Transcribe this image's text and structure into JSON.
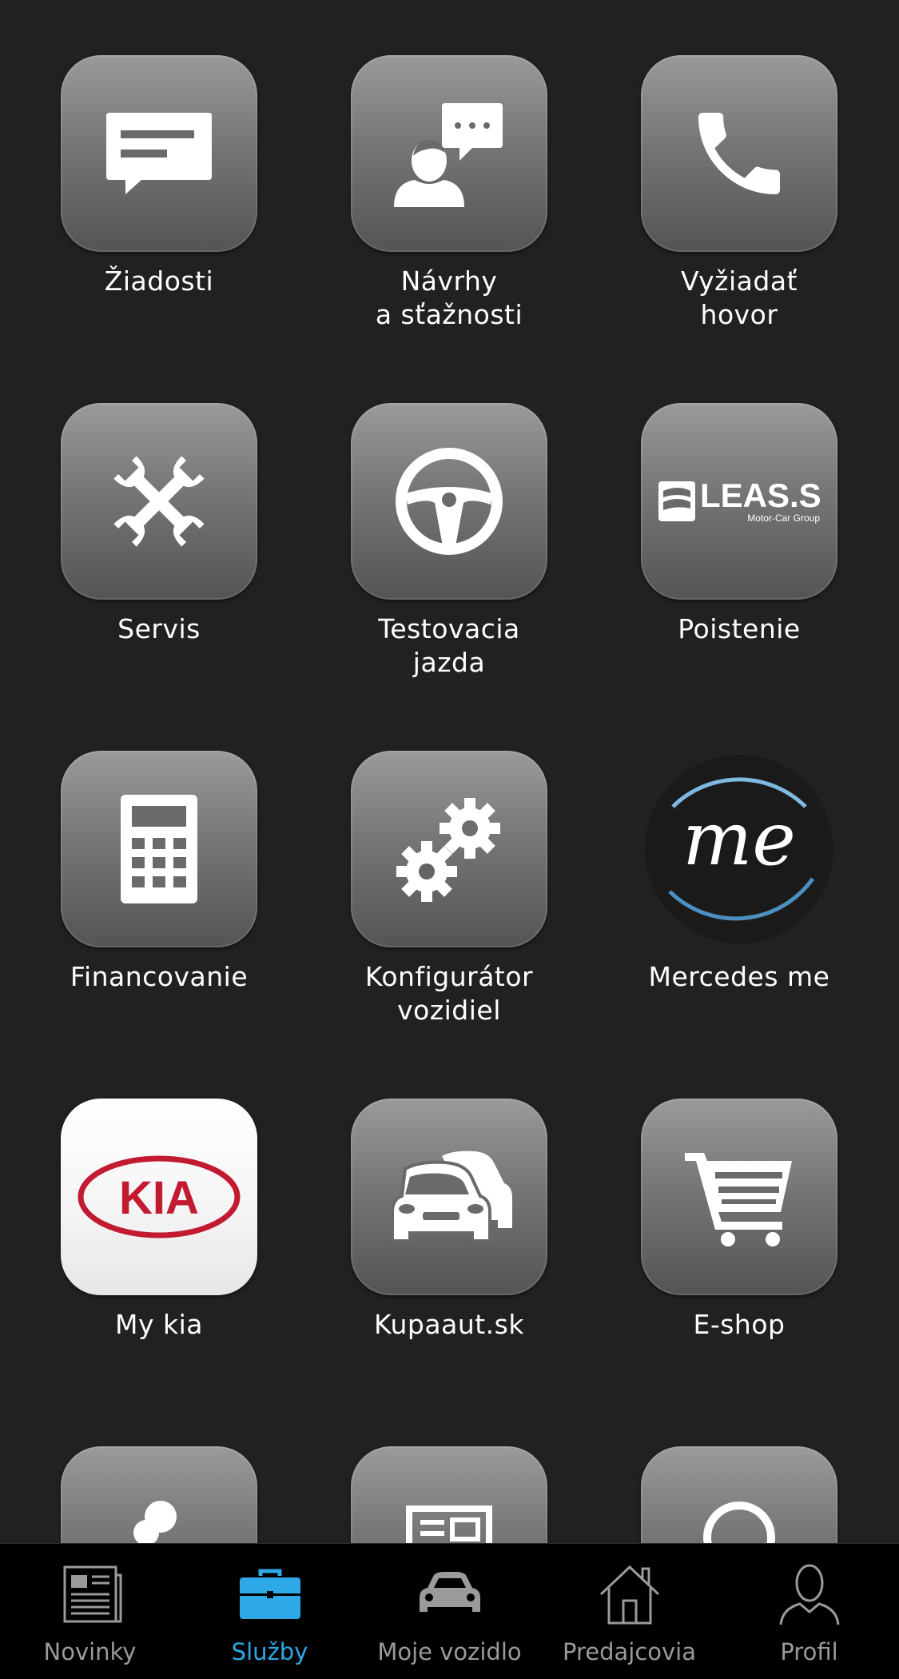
{
  "services": {
    "rows": [
      [
        {
          "label_line1": "Žiadosti",
          "label_line2": "",
          "icon": "chat-bubble-icon"
        },
        {
          "label_line1": "Návrhy",
          "label_line2": "a sťažnosti",
          "icon": "person-speech-icon"
        },
        {
          "label_line1": "Vyžiadať",
          "label_line2": "hovor",
          "icon": "phone-icon"
        }
      ],
      [
        {
          "label_line1": "Servis",
          "label_line2": "",
          "icon": "wrenches-icon"
        },
        {
          "label_line1": "Testovacia",
          "label_line2": "jazda",
          "icon": "steering-wheel-icon"
        },
        {
          "label_line1": "Poistenie",
          "label_line2": "",
          "icon": "leas-logo"
        }
      ],
      [
        {
          "label_line1": "Financovanie",
          "label_line2": "",
          "icon": "calculator-icon"
        },
        {
          "label_line1": "Konfigurátor",
          "label_line2": "vozidiel",
          "icon": "gears-icon"
        },
        {
          "label_line1": "Mercedes me",
          "label_line2": "",
          "icon": "mercedes-me-logo"
        }
      ],
      [
        {
          "label_line1": "My kia",
          "label_line2": "",
          "icon": "kia-logo"
        },
        {
          "label_line1": "Kupaaut.sk",
          "label_line2": "",
          "icon": "cars-icon"
        },
        {
          "label_line1": "E-shop",
          "label_line2": "",
          "icon": "shopping-cart-icon"
        }
      ]
    ]
  },
  "leas_logo": {
    "text": "LEAS.SK",
    "subtext": "Motor-Car Group"
  },
  "mercedes_logo": {
    "text": "me"
  },
  "kia_logo": {
    "text": "KIA"
  },
  "tabbar": {
    "tabs": [
      {
        "label": "Novinky",
        "icon": "newspaper-icon",
        "active": false
      },
      {
        "label": "Služby",
        "icon": "briefcase-icon",
        "active": true
      },
      {
        "label": "Moje vozidlo",
        "icon": "car-icon",
        "active": false
      },
      {
        "label": "Predajcovia",
        "icon": "house-icon",
        "active": false
      },
      {
        "label": "Profil",
        "icon": "user-icon",
        "active": false
      }
    ]
  },
  "colors": {
    "background": "#212121",
    "tabbar_bg": "#000000",
    "active_tab": "#2ea8e6",
    "inactive_tab": "#9a9a9a",
    "tile_top": "#9a9a9a",
    "tile_bottom": "#545454",
    "kia_red": "#c21a30"
  }
}
